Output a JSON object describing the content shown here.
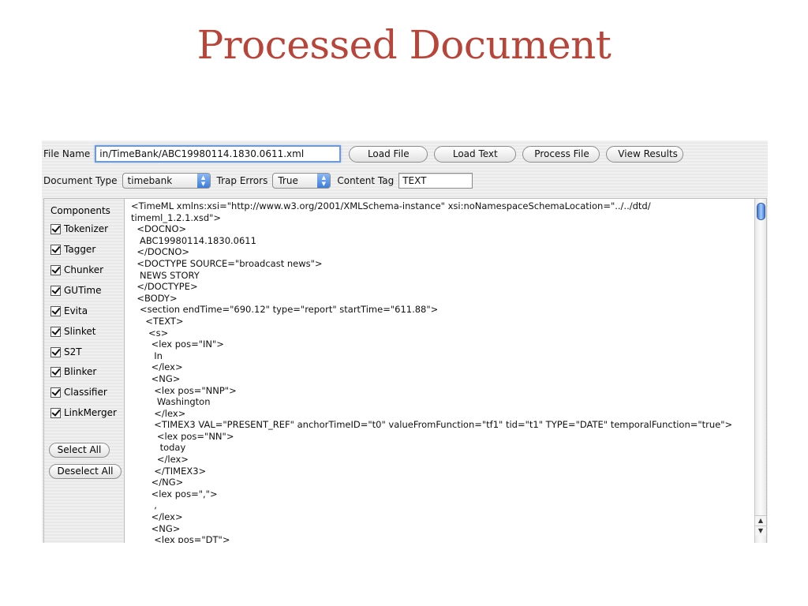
{
  "slide": {
    "title": "Processed Document"
  },
  "toolbar": {
    "file_name_label": "File Name",
    "file_name_value": "in/TimeBank/ABC19980114.1830.0611.xml",
    "load_file": "Load File",
    "load_text": "Load Text",
    "process_file": "Process File",
    "view_results": "View Results",
    "doc_type_label": "Document Type",
    "doc_type_value": "timebank",
    "trap_errors_label": "Trap Errors",
    "trap_errors_value": "True",
    "content_tag_label": "Content Tag",
    "content_tag_value": "TEXT"
  },
  "components": {
    "header": "Components",
    "items": [
      "Tokenizer",
      "Tagger",
      "Chunker",
      "GUTime",
      "Evita",
      "Slinket",
      "S2T",
      "Blinker",
      "Classifier",
      "LinkMerger"
    ],
    "select_all": "Select All",
    "deselect_all": "Deselect All"
  },
  "document": {
    "text": "<TimeML xmlns:xsi=\"http://www.w3.org/2001/XMLSchema-instance\" xsi:noNamespaceSchemaLocation=\"../../dtd/\ntimeml_1.2.1.xsd\">\n  <DOCNO>\n   ABC19980114.1830.0611\n  </DOCNO>\n  <DOCTYPE SOURCE=\"broadcast news\">\n   NEWS STORY\n  </DOCTYPE>\n  <BODY>\n   <section endTime=\"690.12\" type=\"report\" startTime=\"611.88\">\n     <TEXT>\n      <s>\n       <lex pos=\"IN\">\n        In\n       </lex>\n       <NG>\n        <lex pos=\"NNP\">\n         Washington\n        </lex>\n        <TIMEX3 VAL=\"PRESENT_REF\" anchorTimeID=\"t0\" valueFromFunction=\"tf1\" tid=\"t1\" TYPE=\"DATE\" temporalFunction=\"true\">\n         <lex pos=\"NN\">\n          today\n         </lex>\n        </TIMEX3>\n       </NG>\n       <lex pos=\",\">\n        ,\n       </lex>\n       <NG>\n        <lex pos=\"DT\">"
  }
}
